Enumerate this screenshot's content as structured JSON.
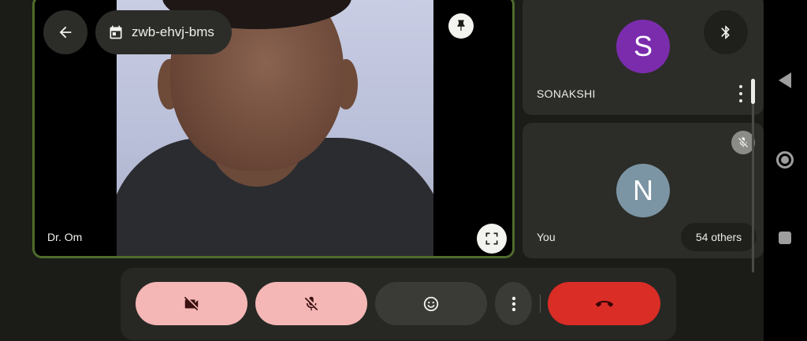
{
  "meeting": {
    "code": "zwb-ehvj-bms"
  },
  "main_tile": {
    "participant_name": "Dr. Om"
  },
  "side_tiles": [
    {
      "name": "SONAKSHI",
      "avatar_letter": "S",
      "avatar_color": "#7b2cad"
    },
    {
      "name": "You",
      "avatar_letter": "N",
      "avatar_color": "#7c95a4",
      "others_label": "54 others"
    }
  ],
  "controls": {
    "camera": "camera-off-icon",
    "microphone": "mic-off-icon",
    "reactions": "emoji-icon",
    "more": "more-vert-icon",
    "end_call": "call-end-icon"
  },
  "colors": {
    "accent_border": "#4f6b2c",
    "muted_button_bg": "#f4b7b5",
    "end_call_bg": "#d92d26"
  }
}
